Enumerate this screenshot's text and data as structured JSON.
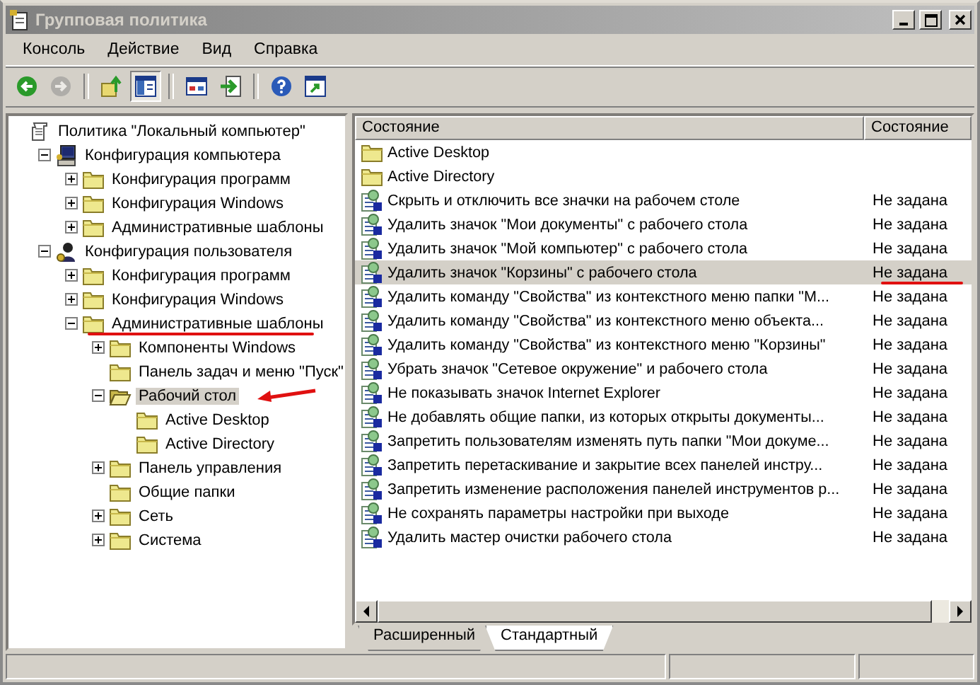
{
  "window": {
    "title": "Групповая политика"
  },
  "menu": [
    "Консоль",
    "Действие",
    "Вид",
    "Справка"
  ],
  "toolbar": [
    {
      "kind": "back",
      "disabled": false,
      "pressed": false
    },
    {
      "kind": "forward",
      "disabled": true,
      "pressed": false
    },
    {
      "kind": "sep"
    },
    {
      "kind": "up",
      "disabled": false,
      "pressed": false
    },
    {
      "kind": "tree",
      "disabled": false,
      "pressed": true
    },
    {
      "kind": "sep"
    },
    {
      "kind": "properties",
      "disabled": false,
      "pressed": false
    },
    {
      "kind": "export",
      "disabled": false,
      "pressed": false
    },
    {
      "kind": "sep"
    },
    {
      "kind": "help",
      "disabled": false,
      "pressed": false
    },
    {
      "kind": "console",
      "disabled": false,
      "pressed": false
    }
  ],
  "tree": [
    {
      "label": "Политика \"Локальный компьютер\"",
      "kind": "policy",
      "selected": false,
      "children": [
        {
          "label": "Конфигурация компьютера",
          "kind": "computer",
          "expanded": true,
          "selected": false,
          "children": [
            {
              "label": "Конфигурация программ",
              "kind": "folder",
              "expanded": false,
              "selected": false
            },
            {
              "label": "Конфигурация Windows",
              "kind": "folder",
              "expanded": false,
              "selected": false
            },
            {
              "label": "Административные шаблоны",
              "kind": "folder",
              "expanded": false,
              "selected": false
            }
          ]
        },
        {
          "label": "Конфигурация пользователя",
          "kind": "user",
          "expanded": true,
          "selected": false,
          "children": [
            {
              "label": "Конфигурация программ",
              "kind": "folder",
              "expanded": false,
              "selected": false
            },
            {
              "label": "Конфигурация Windows",
              "kind": "folder",
              "expanded": false,
              "selected": false
            },
            {
              "label": "Административные шаблоны",
              "kind": "folder",
              "expanded": true,
              "selected": false,
              "underlined": true,
              "children": [
                {
                  "label": "Компоненты Windows",
                  "kind": "folder",
                  "expanded": false,
                  "selected": false
                },
                {
                  "label": "Панель задач и меню \"Пуск\"",
                  "kind": "folder",
                  "selected": false
                },
                {
                  "label": "Рабочий стол",
                  "kind": "open-folder",
                  "expanded": true,
                  "selected": true,
                  "arrow": true,
                  "children": [
                    {
                      "label": "Active Desktop",
                      "kind": "folder",
                      "selected": false
                    },
                    {
                      "label": "Active Directory",
                      "kind": "folder",
                      "selected": false
                    }
                  ]
                },
                {
                  "label": "Панель управления",
                  "kind": "folder",
                  "expanded": false,
                  "selected": false
                },
                {
                  "label": "Общие папки",
                  "kind": "folder",
                  "selected": false
                },
                {
                  "label": "Сеть",
                  "kind": "folder",
                  "expanded": false,
                  "selected": false
                },
                {
                  "label": "Система",
                  "kind": "folder",
                  "expanded": false,
                  "selected": false
                }
              ]
            }
          ]
        }
      ]
    }
  ],
  "list": {
    "columns": [
      "Состояние",
      "Состояние"
    ],
    "rows": [
      {
        "kind": "folder",
        "name": "Active Desktop",
        "selected": false
      },
      {
        "kind": "folder",
        "name": "Active Directory",
        "selected": false
      },
      {
        "kind": "setting",
        "name": "Скрыть и отключить все значки на рабочем столе",
        "state": "Не задана",
        "selected": false
      },
      {
        "kind": "setting",
        "name": "Удалить значок \"Мои документы\" с рабочего стола",
        "state": "Не задана",
        "selected": false
      },
      {
        "kind": "setting",
        "name": "Удалить значок \"Мой компьютер\" с рабочего стола",
        "state": "Не задана",
        "selected": false
      },
      {
        "kind": "setting",
        "name": "Удалить значок \"Корзины\" с рабочего стола",
        "state": "Не задана",
        "selected": true,
        "underlined": true
      },
      {
        "kind": "setting",
        "name": "Удалить команду \"Свойства\" из контекстного меню папки \"М...",
        "state": "Не задана",
        "selected": false
      },
      {
        "kind": "setting",
        "name": "Удалить команду \"Свойства\" из контекстного меню объекта...",
        "state": "Не задана",
        "selected": false
      },
      {
        "kind": "setting",
        "name": "Удалить команду \"Свойства\" из контекстного меню \"Корзины\"",
        "state": "Не задана",
        "selected": false
      },
      {
        "kind": "setting",
        "name": "Убрать значок \"Сетевое окружение\" и рабочего стола",
        "state": "Не задана",
        "selected": false
      },
      {
        "kind": "setting",
        "name": "Не показывать значок Internet Explorer",
        "state": "Не задана",
        "selected": false
      },
      {
        "kind": "setting",
        "name": "Не добавлять общие папки, из которых открыты документы...",
        "state": "Не задана",
        "selected": false
      },
      {
        "kind": "setting",
        "name": "Запретить пользователям изменять путь папки \"Мои докуме...",
        "state": "Не задана",
        "selected": false
      },
      {
        "kind": "setting",
        "name": "Запретить перетаскивание и закрытие всех панелей инстру...",
        "state": "Не задана",
        "selected": false
      },
      {
        "kind": "setting",
        "name": "Запретить изменение расположения панелей инструментов р...",
        "state": "Не задана",
        "selected": false
      },
      {
        "kind": "setting",
        "name": "Не сохранять параметры настройки при выходе",
        "state": "Не задана",
        "selected": false
      },
      {
        "kind": "setting",
        "name": "Удалить мастер очистки рабочего стола",
        "state": "Не задана",
        "selected": false
      }
    ]
  },
  "tabs": [
    {
      "label": "Расширенный",
      "selected": false
    },
    {
      "label": "Стандартный",
      "selected": true
    }
  ]
}
